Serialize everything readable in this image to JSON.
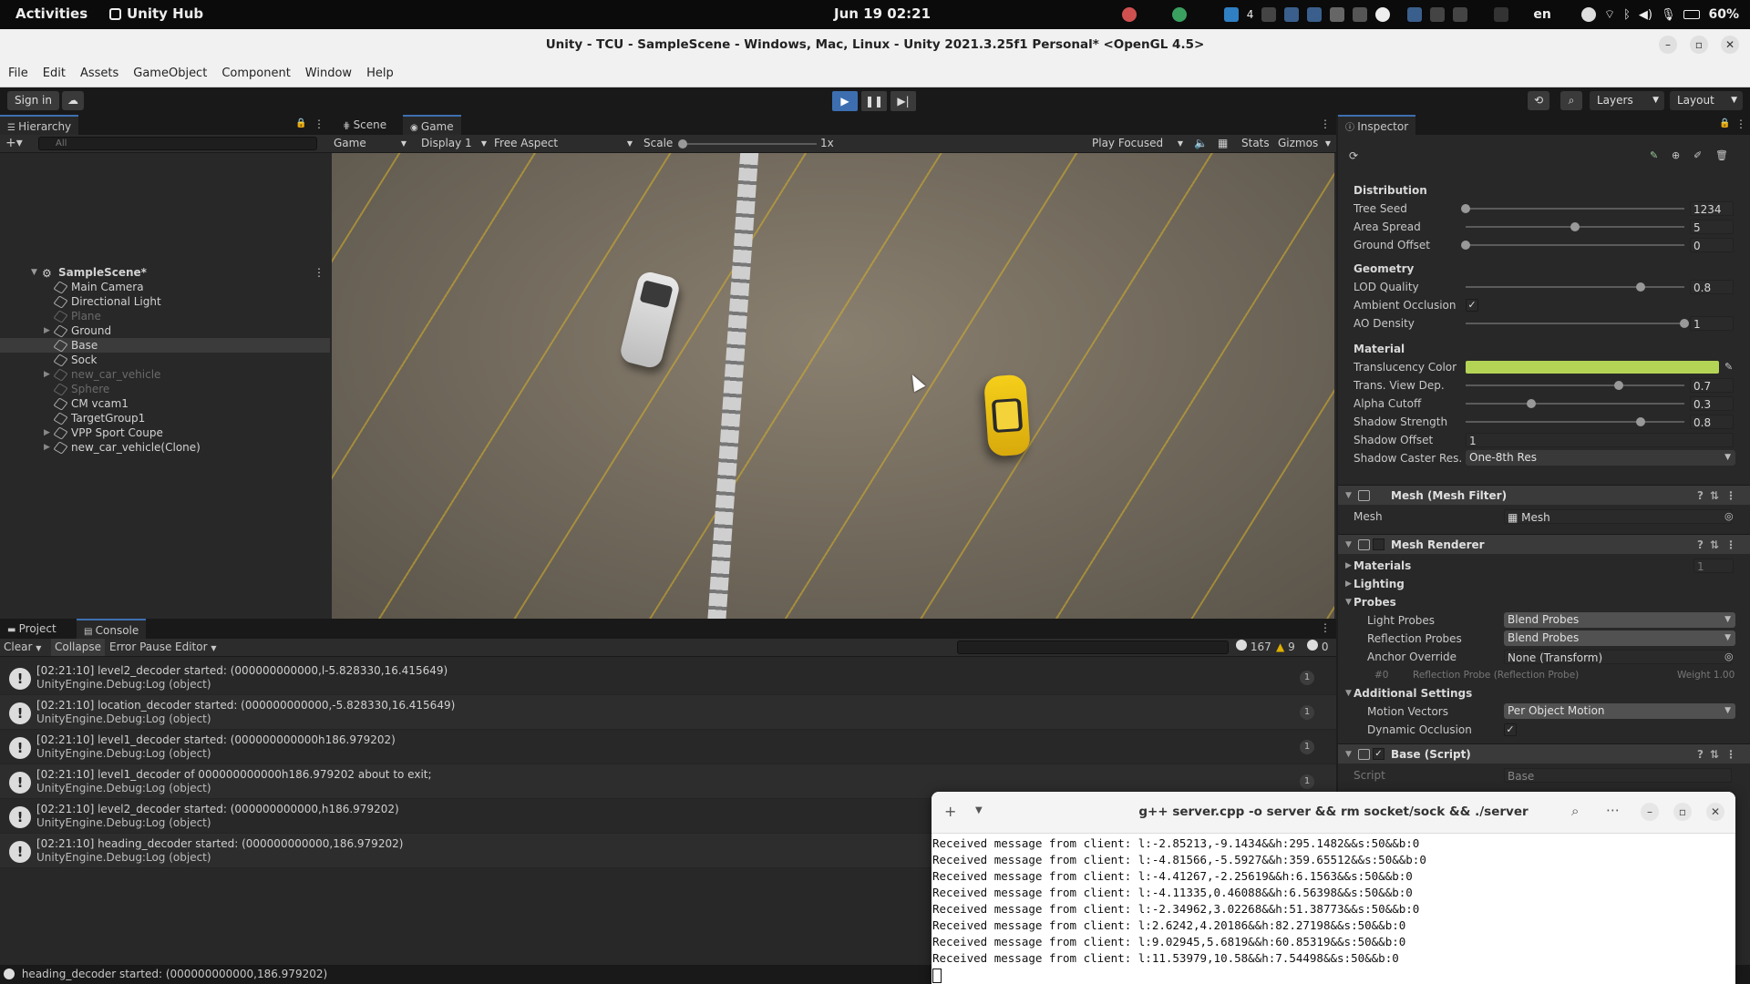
{
  "topbar": {
    "activities": "Activities",
    "app_name": "Unity Hub",
    "clock": "Jun 19  02:21",
    "workspace_num": "4",
    "language": "en",
    "battery": "60%"
  },
  "window": {
    "title": "Unity - TCU - SampleScene - Windows, Mac, Linux - Unity 2021.3.25f1 Personal* <OpenGL 4.5>"
  },
  "menu": [
    "File",
    "Edit",
    "Assets",
    "GameObject",
    "Component",
    "Window",
    "Help"
  ],
  "toolbar": {
    "sign_in": "Sign in",
    "layers": "Layers",
    "layout": "Layout"
  },
  "hierarchy": {
    "tab": "Hierarchy",
    "search_placeholder": "All",
    "scene": "SampleScene*",
    "items": [
      {
        "label": "Main Camera",
        "dim": false,
        "expandable": false
      },
      {
        "label": "Directional Light",
        "dim": false,
        "expandable": false
      },
      {
        "label": "Plane",
        "dim": true,
        "expandable": false
      },
      {
        "label": "Ground",
        "dim": false,
        "expandable": true
      },
      {
        "label": "Base",
        "dim": false,
        "expandable": false
      },
      {
        "label": "Sock",
        "dim": false,
        "expandable": false
      },
      {
        "label": "new_car_vehicle",
        "dim": true,
        "expandable": true
      },
      {
        "label": "Sphere",
        "dim": true,
        "expandable": false
      },
      {
        "label": "CM vcam1",
        "dim": false,
        "expandable": false
      },
      {
        "label": "TargetGroup1",
        "dim": false,
        "expandable": false
      },
      {
        "label": "VPP Sport Coupe",
        "dim": false,
        "expandable": true
      },
      {
        "label": "new_car_vehicle(Clone)",
        "dim": false,
        "expandable": true
      }
    ]
  },
  "game": {
    "tabs": [
      "Scene",
      "Game"
    ],
    "mode": "Game",
    "display": "Display 1",
    "aspect": "Free Aspect",
    "scale_label": "Scale",
    "scale_value": "1x",
    "play_focused": "Play Focused",
    "stats": "Stats",
    "gizmos": "Gizmos"
  },
  "inspector": {
    "tab": "Inspector",
    "distribution": {
      "header": "Distribution",
      "rows": [
        {
          "label": "Tree Seed",
          "value": "1234",
          "pos": 0.0
        },
        {
          "label": "Area Spread",
          "value": "5",
          "pos": 0.5
        },
        {
          "label": "Ground Offset",
          "value": "0",
          "pos": 0.0
        }
      ]
    },
    "geometry": {
      "header": "Geometry",
      "lod_quality": {
        "label": "LOD Quality",
        "value": "0.8",
        "pos": 0.8
      },
      "ambient_occlusion": {
        "label": "Ambient Occlusion",
        "checked": true
      },
      "ao_density": {
        "label": "AO Density",
        "value": "1",
        "pos": 1.0
      }
    },
    "material": {
      "header": "Material",
      "translucency_label": "Translucency Color",
      "translucency_color": "#b4d455",
      "rows": [
        {
          "label": "Trans. View Dep.",
          "value": "0.7",
          "pos": 0.7
        },
        {
          "label": "Alpha Cutoff",
          "value": "0.3",
          "pos": 0.3
        },
        {
          "label": "Shadow Strength",
          "value": "0.8",
          "pos": 0.8
        }
      ],
      "shadow_offset_label": "Shadow Offset",
      "shadow_offset_value": "1",
      "shadow_caster_label": "Shadow Caster Res.",
      "shadow_caster_value": "One-8th Res"
    },
    "mesh_filter": {
      "title": "Mesh (Mesh Filter)",
      "mesh_label": "Mesh",
      "mesh_value": "Mesh"
    },
    "mesh_renderer": {
      "title": "Mesh Renderer",
      "materials": "Materials",
      "materials_count": "1",
      "lighting": "Lighting",
      "probes": "Probes",
      "light_probes_label": "Light Probes",
      "light_probes_value": "Blend Probes",
      "reflection_probes_label": "Reflection Probes",
      "reflection_probes_value": "Blend Probes",
      "anchor_label": "Anchor Override",
      "anchor_value": "None (Transform)",
      "probe_index": "#0",
      "probe_name": "Reflection Probe (Reflection Probe)",
      "probe_weight": "Weight 1.00",
      "additional": "Additional Settings",
      "motion_vectors_label": "Motion Vectors",
      "motion_vectors_value": "Per Object Motion",
      "dynamic_occlusion_label": "Dynamic Occlusion",
      "dynamic_occlusion_checked": true
    },
    "base_script": {
      "title": "Base (Script)",
      "script_label": "Script",
      "script_value": "Base"
    }
  },
  "console": {
    "tabs": [
      "Project",
      "Console"
    ],
    "clear": "Clear",
    "collapse": "Collapse",
    "error_pause": "Error Pause",
    "editor": "Editor",
    "count_log": "167",
    "count_warn": "9",
    "count_error": "0",
    "entries": [
      {
        "line1": "[02:21:10] level2_decoder started: (000000000000,l-5.828330,16.415649)",
        "line2": "UnityEngine.Debug:Log (object)",
        "count": "1"
      },
      {
        "line1": "[02:21:10] location_decoder started: (000000000000,-5.828330,16.415649)",
        "line2": "UnityEngine.Debug:Log (object)",
        "count": "1"
      },
      {
        "line1": "[02:21:10] level1_decoder started: (000000000000h186.979202)",
        "line2": "UnityEngine.Debug:Log (object)",
        "count": "1"
      },
      {
        "line1": "[02:21:10] level1_decoder of 000000000000h186.979202 about to exit;",
        "line2": "UnityEngine.Debug:Log (object)",
        "count": "1"
      },
      {
        "line1": "[02:21:10] level2_decoder started: (000000000000,h186.979202)",
        "line2": "UnityEngine.Debug:Log (object)",
        "count": "1"
      },
      {
        "line1": "[02:21:10] heading_decoder started: (000000000000,186.979202)",
        "line2": "UnityEngine.Debug:Log (object)",
        "count": "1"
      }
    ]
  },
  "statusbar": {
    "message": "heading_decoder started: (000000000000,186.979202)"
  },
  "terminal": {
    "title": "g++ server.cpp -o server && rm socket/sock && ./server",
    "lines": [
      "Received message from client: l:-2.85213,-9.1434&&h:295.1482&&s:50&&b:0",
      "Received message from client: l:-4.81566,-5.5927&&h:359.65512&&s:50&&b:0",
      "Received message from client: l:-4.41267,-2.25619&&h:6.1563&&s:50&&b:0",
      "Received message from client: l:-4.11335,0.46088&&h:6.56398&&s:50&&b:0",
      "Received message from client: l:-2.34962,3.02268&&h:51.38773&&s:50&&b:0",
      "Received message from client: l:2.6242,4.20186&&h:82.27198&&s:50&&b:0",
      "Received message from client: l:9.02945,5.6819&&h:60.85319&&s:50&&b:0",
      "Received message from client: l:11.53979,10.58&&h:7.54498&&s:50&&b:0"
    ]
  }
}
